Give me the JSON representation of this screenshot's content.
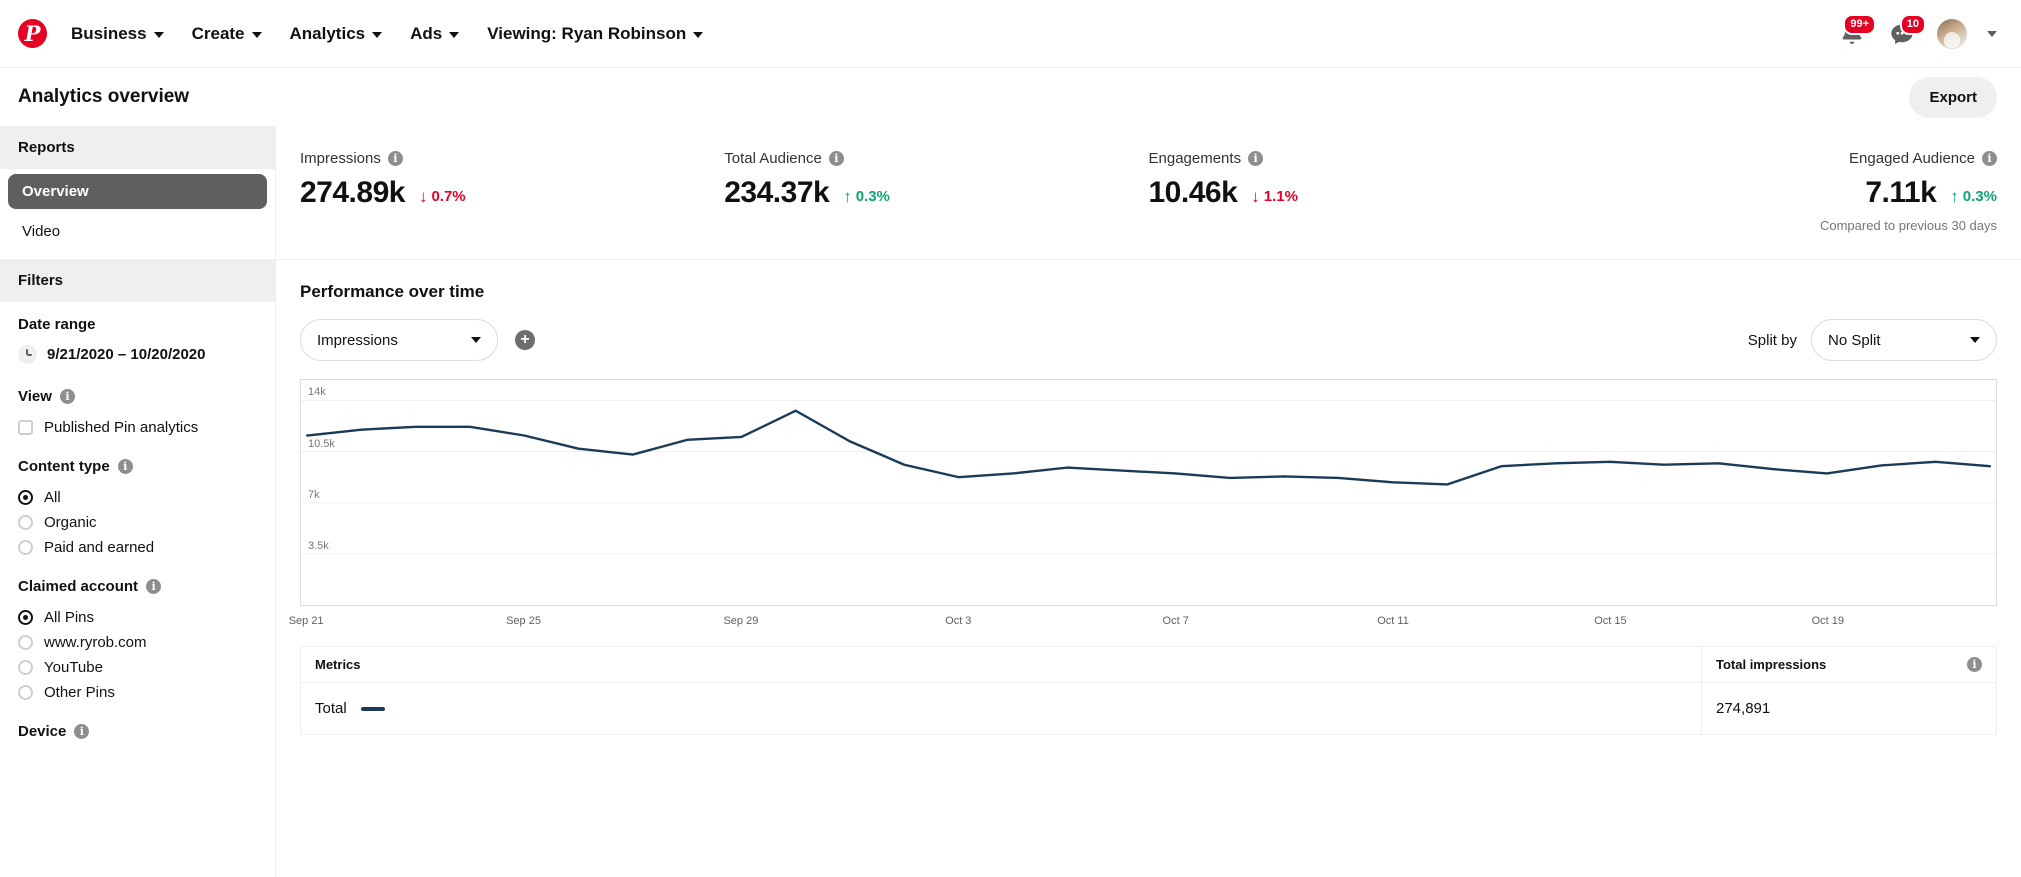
{
  "topnav": {
    "logo_icon": "pinterest-logo-icon",
    "items": [
      {
        "label": "Business",
        "icon": "chevron-down-icon"
      },
      {
        "label": "Create",
        "icon": "chevron-down-icon"
      },
      {
        "label": "Analytics",
        "icon": "chevron-down-icon"
      },
      {
        "label": "Ads",
        "icon": "chevron-down-icon"
      },
      {
        "label": "Viewing: Ryan Robinson",
        "icon": "chevron-down-icon"
      }
    ],
    "notifications_badge": "99+",
    "messages_badge": "10",
    "notifications_icon": "bell-icon",
    "messages_icon": "message-bubble-icon",
    "avatar_icon": "user-avatar",
    "account_chevron_icon": "chevron-down-icon"
  },
  "page": {
    "title": "Analytics overview",
    "export_label": "Export"
  },
  "sidebar": {
    "reports_header": "Reports",
    "reports_items": [
      {
        "label": "Overview",
        "active": true
      },
      {
        "label": "Video",
        "active": false
      }
    ],
    "filters_header": "Filters",
    "date_range": {
      "label": "Date range",
      "value": "9/21/2020 – 10/20/2020",
      "icon": "clock-icon"
    },
    "view": {
      "label": "View",
      "info_icon": "info-icon",
      "options": [
        {
          "label": "Published Pin analytics",
          "checked": false
        }
      ]
    },
    "content_type": {
      "label": "Content type",
      "info_icon": "info-icon",
      "options": [
        {
          "label": "All",
          "selected": true
        },
        {
          "label": "Organic",
          "selected": false
        },
        {
          "label": "Paid and earned",
          "selected": false
        }
      ]
    },
    "claimed_account": {
      "label": "Claimed account",
      "info_icon": "info-icon",
      "options": [
        {
          "label": "All Pins",
          "selected": true
        },
        {
          "label": "www.ryrob.com",
          "selected": false
        },
        {
          "label": "YouTube",
          "selected": false
        },
        {
          "label": "Other Pins",
          "selected": false
        }
      ]
    },
    "device": {
      "label": "Device",
      "info_icon": "info-icon"
    }
  },
  "metrics": [
    {
      "label": "Impressions",
      "value": "274.89k",
      "delta": "0.7%",
      "direction": "down",
      "arrow": "↓",
      "info_icon": "info-icon"
    },
    {
      "label": "Total Audience",
      "value": "234.37k",
      "delta": "0.3%",
      "direction": "up",
      "arrow": "↑",
      "info_icon": "info-icon"
    },
    {
      "label": "Engagements",
      "value": "10.46k",
      "delta": "1.1%",
      "direction": "down",
      "arrow": "↓",
      "info_icon": "info-icon"
    },
    {
      "label": "Engaged Audience",
      "value": "7.11k",
      "delta": "0.3%",
      "direction": "up",
      "arrow": "↑",
      "info_icon": "info-icon"
    }
  ],
  "metrics_footnote": "Compared to previous 30 days",
  "chart_section": {
    "title": "Performance over time",
    "metric_select_value": "Impressions",
    "metric_select_icon": "chevron-down-icon",
    "add_metric_icon": "plus-circle-icon",
    "split_by_label": "Split by",
    "split_select_value": "No Split",
    "split_select_icon": "chevron-down-icon"
  },
  "chart_data": {
    "type": "line",
    "title": "Performance over time",
    "xlabel": "",
    "ylabel": "",
    "ylim": [
      0,
      15400
    ],
    "grid": true,
    "legend_position": "table-below",
    "line_color": "#1b3a57",
    "y_ticks": [
      "3.5k",
      "7k",
      "10.5k",
      "14k"
    ],
    "y_tick_values": [
      3500,
      7000,
      10500,
      14000
    ],
    "x_ticks": [
      "Sep 21",
      "Sep 25",
      "Sep 29",
      "Oct 3",
      "Oct 7",
      "Oct 11",
      "Oct 15",
      "Oct 19"
    ],
    "x": [
      "Sep 21",
      "Sep 22",
      "Sep 23",
      "Sep 24",
      "Sep 25",
      "Sep 26",
      "Sep 27",
      "Sep 28",
      "Sep 29",
      "Sep 30",
      "Oct 1",
      "Oct 2",
      "Oct 3",
      "Oct 4",
      "Oct 5",
      "Oct 6",
      "Oct 7",
      "Oct 8",
      "Oct 9",
      "Oct 10",
      "Oct 11",
      "Oct 12",
      "Oct 13",
      "Oct 14",
      "Oct 15",
      "Oct 16",
      "Oct 17",
      "Oct 18",
      "Oct 19",
      "Oct 20"
    ],
    "series": [
      {
        "name": "Total",
        "values": [
          11600,
          12000,
          12200,
          12200,
          11600,
          10700,
          10300,
          11300,
          11500,
          13300,
          11200,
          9600,
          8750,
          9000,
          9400,
          9200,
          9000,
          8700,
          8800,
          8700,
          8400,
          8250,
          9500,
          9700,
          9800,
          9600,
          9700,
          9300,
          9000,
          9550,
          9800,
          9500
        ]
      }
    ]
  },
  "metrics_table": {
    "columns": [
      {
        "label": "Metrics",
        "info_icon": null
      },
      {
        "label": "Total impressions",
        "info_icon": "info-icon"
      }
    ],
    "rows": [
      {
        "name": "Total",
        "legend_icon": "line-swatch",
        "total_impressions": "274,891"
      }
    ]
  }
}
